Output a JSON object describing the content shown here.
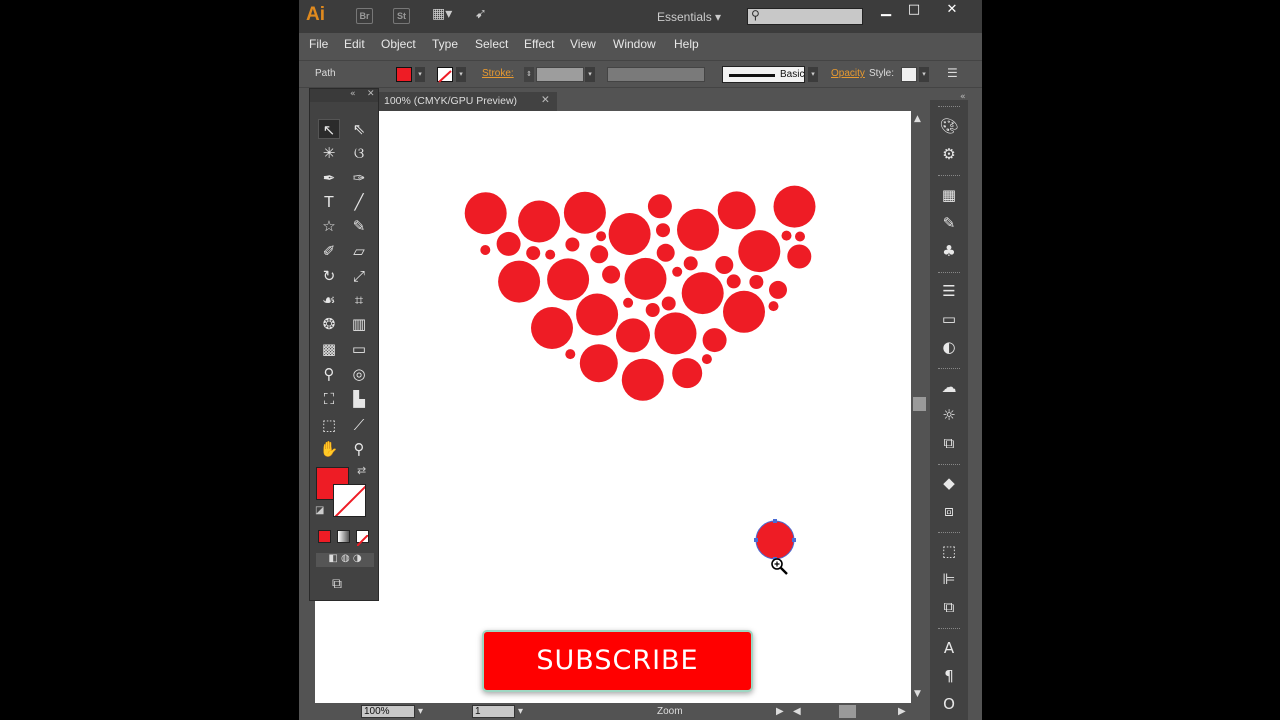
{
  "app": {
    "logo": "Ai",
    "bridge": "Br",
    "stock": "St",
    "workspace": "Essentials",
    "search_placeholder": ""
  },
  "window": {
    "minimize": "▁",
    "maximize": "□",
    "close": "✕"
  },
  "menu": [
    "File",
    "Edit",
    "Object",
    "Type",
    "Select",
    "Effect",
    "View",
    "Window",
    "Help"
  ],
  "control": {
    "selection": "Path",
    "stroke_label": "Stroke:",
    "brush": "Basic",
    "opacity_label": "Opacity",
    "style_label": "Style:"
  },
  "colors": {
    "fill": "#ee1c25",
    "accent": "#e8992f"
  },
  "doc": {
    "tab_title": "100% (CMYK/GPU Preview)",
    "close": "✕"
  },
  "status": {
    "zoom": "100%",
    "artboard": "1",
    "tool_name": "Zoom"
  },
  "overlay": {
    "subscribe": "SUBSCRIBE"
  }
}
